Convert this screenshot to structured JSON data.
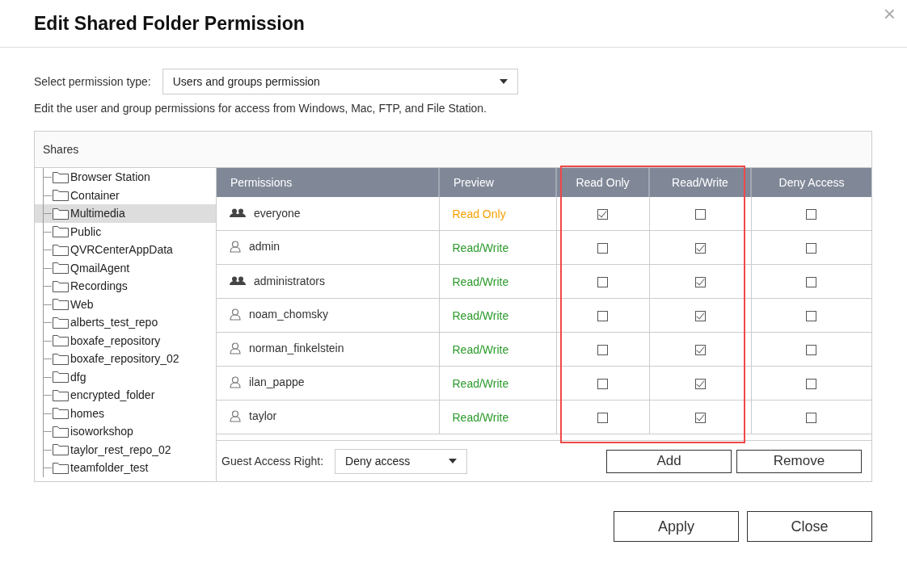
{
  "dialog": {
    "title": "Edit Shared Folder Permission",
    "close": "×"
  },
  "permission_type": {
    "label": "Select permission type:",
    "value": "Users and groups permission"
  },
  "description": "Edit the user and group permissions for access from Windows, Mac, FTP, and File Station.",
  "shares": {
    "title": "Shares",
    "items": [
      {
        "name": "Browser Station",
        "selected": false
      },
      {
        "name": "Container",
        "selected": false
      },
      {
        "name": "Multimedia",
        "selected": true
      },
      {
        "name": "Public",
        "selected": false
      },
      {
        "name": "QVRCenterAppData",
        "selected": false
      },
      {
        "name": "QmailAgent",
        "selected": false
      },
      {
        "name": "Recordings",
        "selected": false
      },
      {
        "name": "Web",
        "selected": false
      },
      {
        "name": "alberts_test_repo",
        "selected": false
      },
      {
        "name": "boxafe_repository",
        "selected": false
      },
      {
        "name": "boxafe_repository_02",
        "selected": false
      },
      {
        "name": "dfg",
        "selected": false
      },
      {
        "name": "encrypted_folder",
        "selected": false
      },
      {
        "name": "homes",
        "selected": false
      },
      {
        "name": "isoworkshop",
        "selected": false
      },
      {
        "name": "taylor_rest_repo_02",
        "selected": false
      },
      {
        "name": "teamfolder_test",
        "selected": false
      }
    ]
  },
  "table": {
    "columns": [
      {
        "label": "Permissions",
        "highlighted": false
      },
      {
        "label": "Preview",
        "highlighted": false
      },
      {
        "label": "Read Only",
        "highlighted": true
      },
      {
        "label": "Read/Write",
        "highlighted": true
      },
      {
        "label": "Deny Access",
        "highlighted": false
      }
    ],
    "rows": [
      {
        "kind": "group",
        "name": "everyone",
        "preview": "Read Only",
        "color": "#f5a000",
        "read_only": true,
        "read_write": false,
        "deny": false
      },
      {
        "kind": "user",
        "name": "admin",
        "preview": "Read/Write",
        "color": "#2a9a2a",
        "read_only": false,
        "read_write": true,
        "deny": false
      },
      {
        "kind": "group",
        "name": "administrators",
        "preview": "Read/Write",
        "color": "#2a9a2a",
        "read_only": false,
        "read_write": true,
        "deny": false
      },
      {
        "kind": "user",
        "name": "noam_chomsky",
        "preview": "Read/Write",
        "color": "#2a9a2a",
        "read_only": false,
        "read_write": true,
        "deny": false
      },
      {
        "kind": "user",
        "name": "norman_finkelstein",
        "preview": "Read/Write",
        "color": "#2a9a2a",
        "read_only": false,
        "read_write": true,
        "deny": false
      },
      {
        "kind": "user",
        "name": "ilan_pappe",
        "preview": "Read/Write",
        "color": "#2a9a2a",
        "read_only": false,
        "read_write": true,
        "deny": false
      },
      {
        "kind": "user",
        "name": "taylor",
        "preview": "Read/Write",
        "color": "#2a9a2a",
        "read_only": false,
        "read_write": true,
        "deny": false
      }
    ]
  },
  "guest_access": {
    "label": "Guest Access Right:",
    "value": "Deny access"
  },
  "table_buttons": [
    "Add",
    "Remove"
  ],
  "buttons": [
    "Apply",
    "Close"
  ]
}
